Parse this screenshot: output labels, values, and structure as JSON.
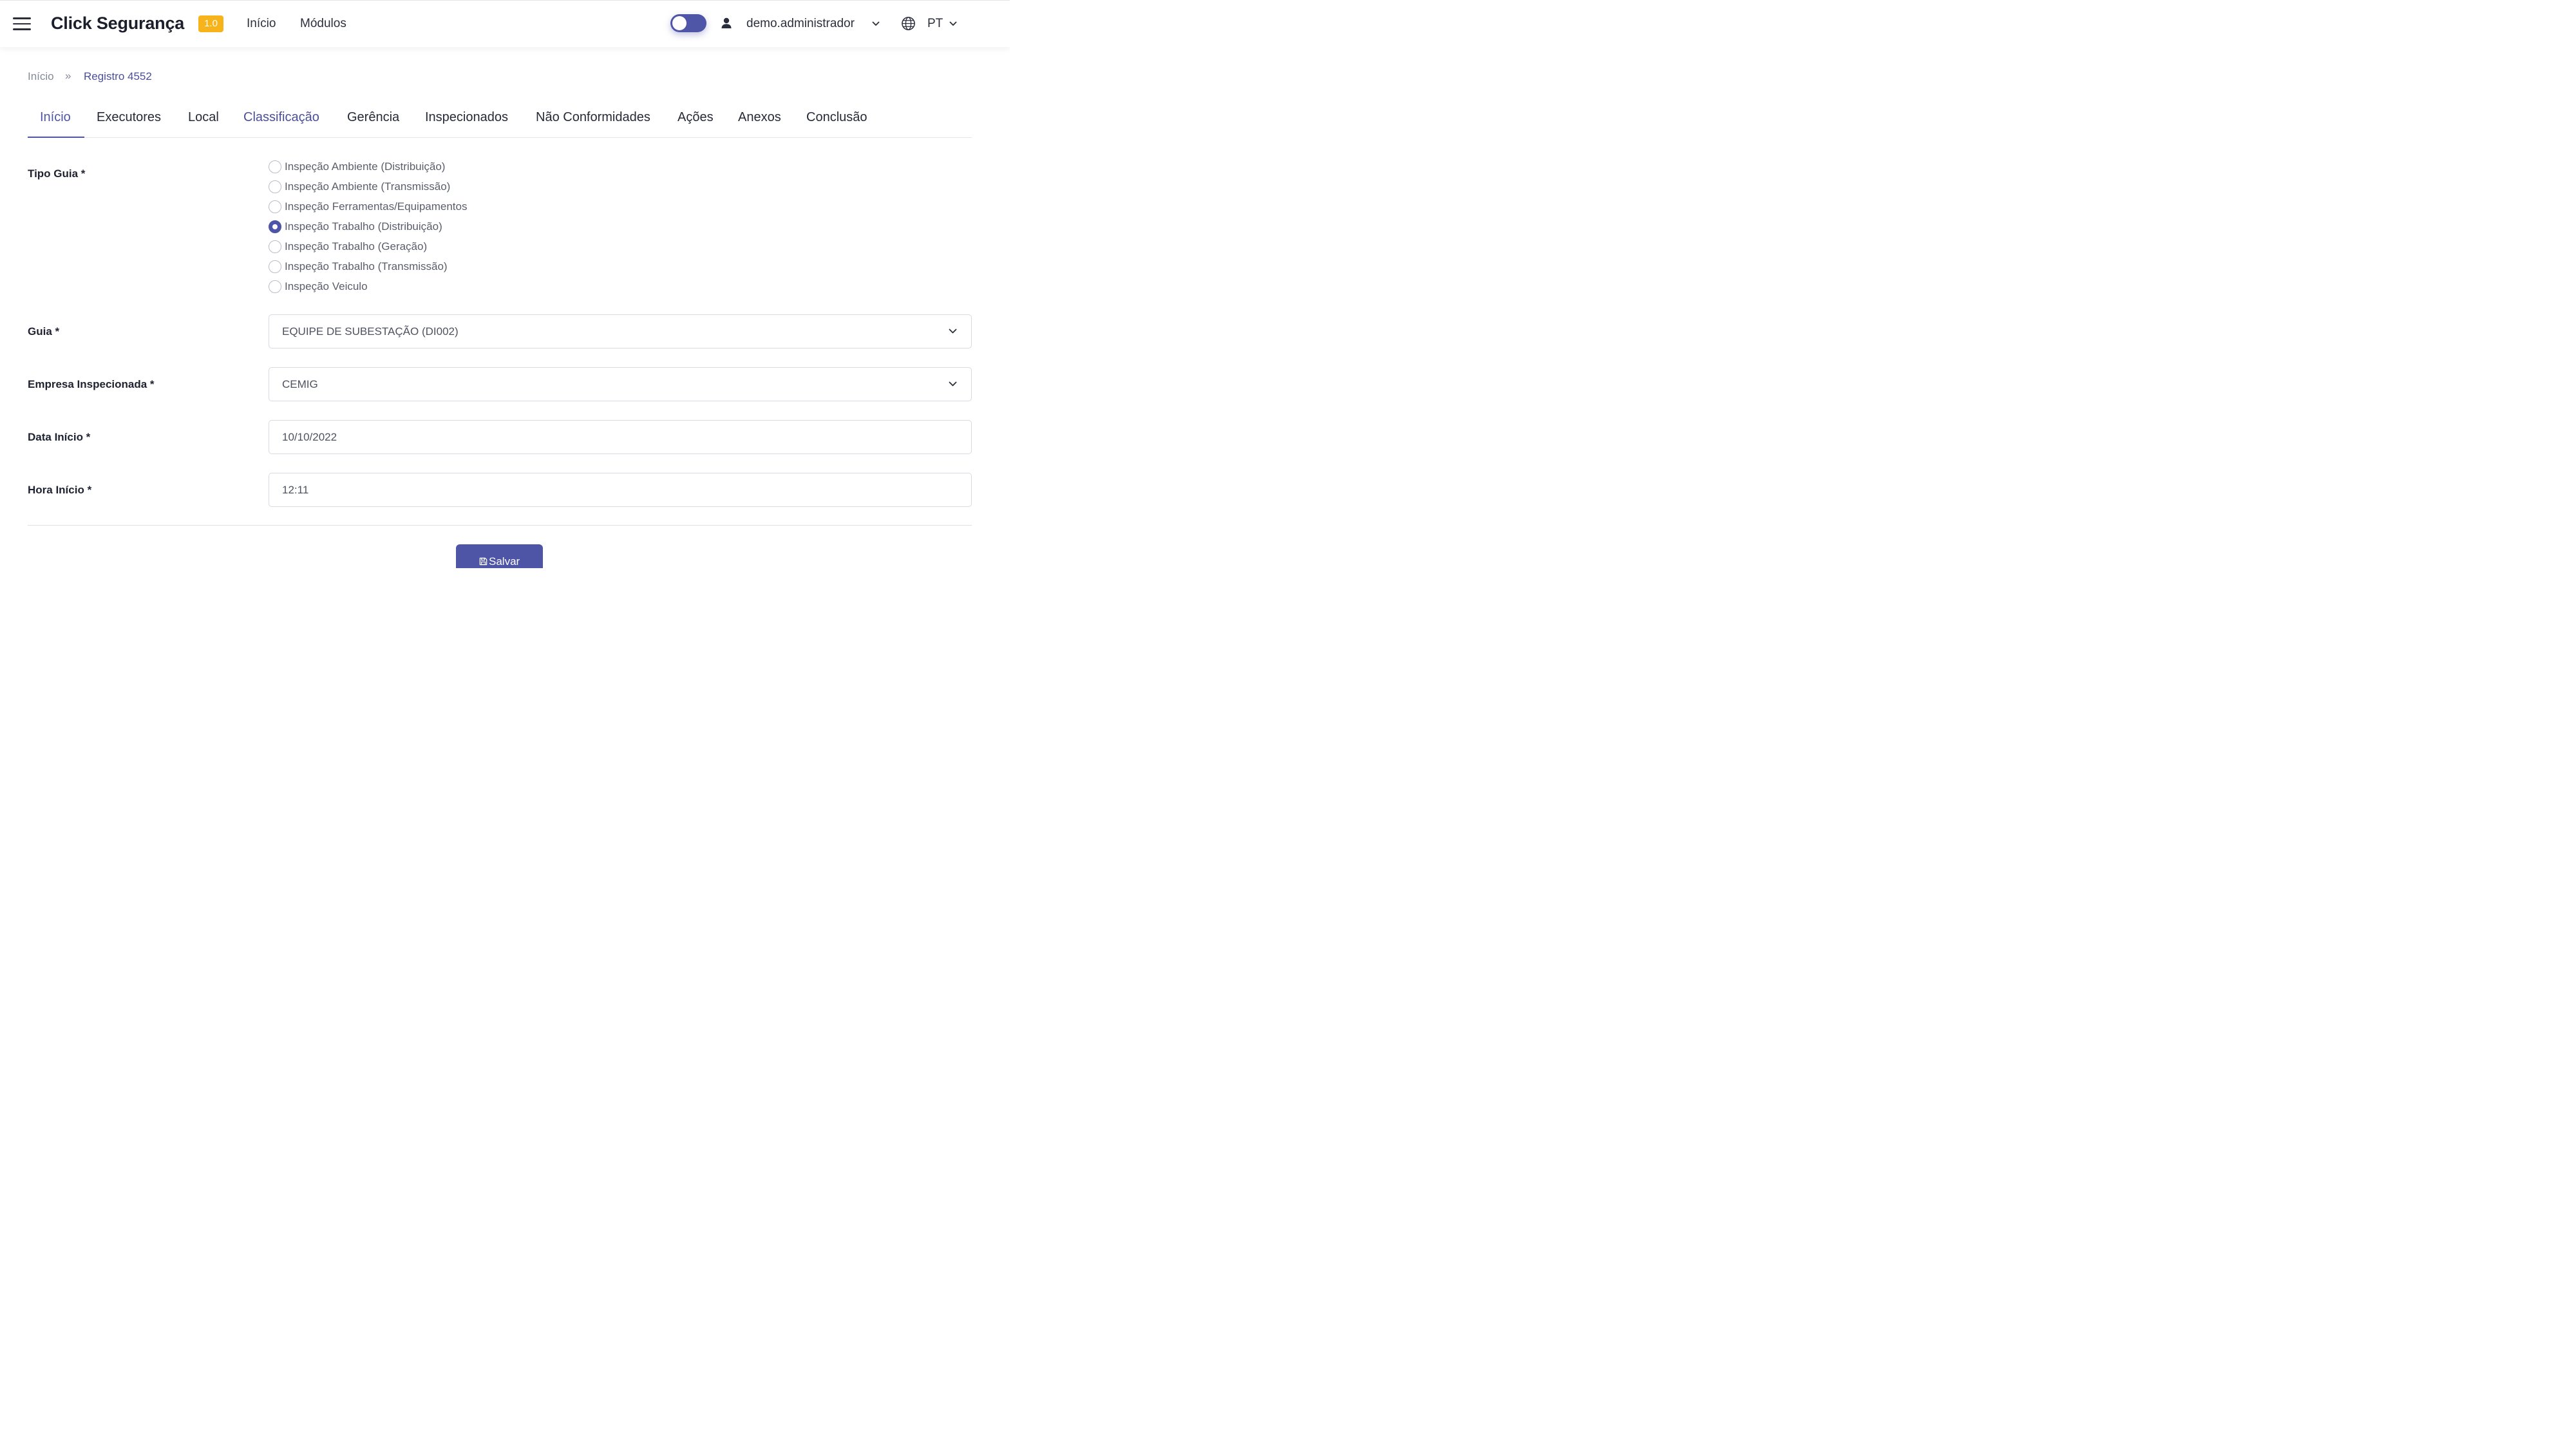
{
  "header": {
    "brand": "Click Segurança",
    "version": "1.0",
    "nav": [
      "Início",
      "Módulos"
    ],
    "user": "demo.administrador",
    "language": "PT",
    "dark_mode_toggle": false
  },
  "breadcrumb": {
    "home": "Início",
    "separator": "»",
    "current": "Registro 4552"
  },
  "tabs": [
    {
      "label": "Início",
      "active": true
    },
    {
      "label": "Executores"
    },
    {
      "label": "Local"
    },
    {
      "label": "Classificação"
    },
    {
      "label": "Gerência"
    },
    {
      "label": "Inspecionados"
    },
    {
      "label": "Não Conformidades"
    },
    {
      "label": "Ações"
    },
    {
      "label": "Anexos"
    },
    {
      "label": "Conclusão"
    }
  ],
  "form": {
    "tipo_guia": {
      "label": "Tipo Guia *",
      "options": [
        "Inspeção Ambiente (Distribuição)",
        "Inspeção Ambiente (Transmissão)",
        "Inspeção Ferramentas/Equipamentos",
        "Inspeção Trabalho (Distribuição)",
        "Inspeção Trabalho (Geração)",
        "Inspeção Trabalho (Transmissão)",
        "Inspeção Veiculo"
      ],
      "selected": "Inspeção Trabalho (Distribuição)"
    },
    "guia": {
      "label": "Guia *",
      "value": "EQUIPE DE SUBESTAÇÃO (DI002)"
    },
    "empresa": {
      "label": "Empresa Inspecionada *",
      "value": "CEMIG"
    },
    "data_inicio": {
      "label": "Data Início *",
      "value": "10/10/2022"
    },
    "hora_inicio": {
      "label": "Hora Início *",
      "value": "12:11"
    }
  },
  "actions": {
    "save_label": "Salvar"
  },
  "colors": {
    "primary": "#4e55a6",
    "badge": "#f7b31a",
    "text_dark": "#1e2230",
    "text_muted": "#858a98"
  }
}
